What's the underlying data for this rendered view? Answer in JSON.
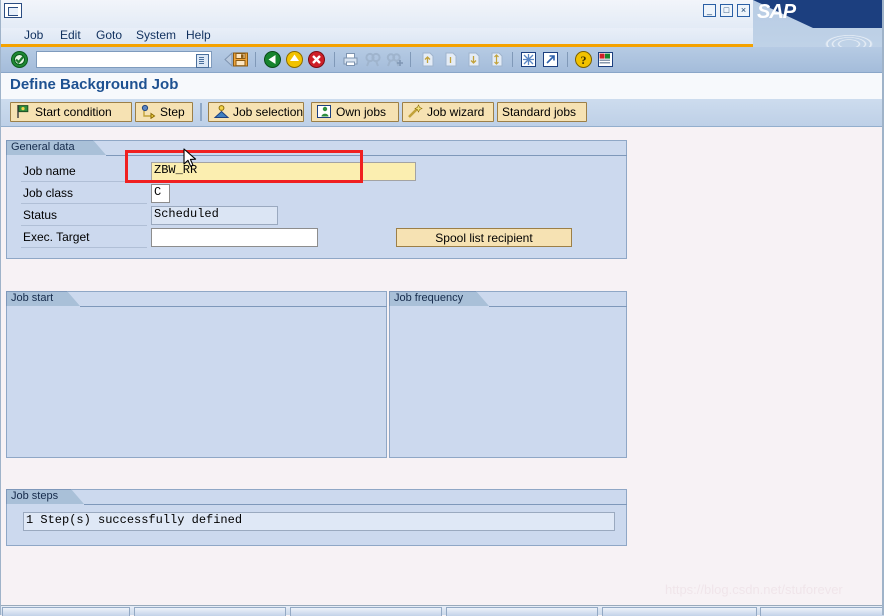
{
  "window": {
    "system_icon": "sap-system-menu-icon",
    "minimize_label": "_",
    "maximize_label": "□",
    "close_label": "×",
    "logo_text": "SAP"
  },
  "menubar": {
    "items": [
      {
        "label": "Job",
        "accel": "J"
      },
      {
        "label": "Edit",
        "accel": "E"
      },
      {
        "label": "Goto",
        "accel": "G"
      },
      {
        "label": "System",
        "accel": "y"
      },
      {
        "label": "Help",
        "accel": "H"
      }
    ]
  },
  "toolbar": {
    "enter_icon": "enter-check-icon",
    "command_field": {
      "value": "",
      "placeholder": "",
      "dropdown_icon": "command-history-icon"
    },
    "icons": [
      "back-arrow-icon",
      "save-icon",
      "green-back-icon",
      "yellow-exit-icon",
      "red-cancel-icon",
      "print-icon",
      "find-icon",
      "find-next-icon",
      "first-page-icon",
      "previous-page-icon",
      "next-page-icon",
      "last-page-icon",
      "create-session-icon",
      "create-shortcut-icon",
      "help-icon",
      "customize-local-layout-icon"
    ]
  },
  "page": {
    "title": "Define Background Job"
  },
  "appbar": {
    "buttons": [
      {
        "label": "Start condition",
        "icon": "flag-icon"
      },
      {
        "label": "Step",
        "icon": "step-icon"
      },
      {
        "label": "Job selection",
        "icon": "job-selection-icon"
      },
      {
        "label": "Own jobs",
        "icon": "own-jobs-icon"
      },
      {
        "label": "Job wizard",
        "icon": "wizard-wand-icon"
      },
      {
        "label": "Standard jobs",
        "icon": ""
      }
    ]
  },
  "general_data": {
    "title": "General data",
    "fields": [
      {
        "label": "Job name",
        "value": "ZBW_RR",
        "state": "required"
      },
      {
        "label": "Job class",
        "value": "C",
        "state": "editable"
      },
      {
        "label": "Status",
        "value": "Scheduled",
        "state": "readonly"
      },
      {
        "label": "Exec. Target",
        "value": "",
        "state": "editable"
      }
    ],
    "spool_button": "Spool list recipient",
    "highlight_color": "#f02020"
  },
  "job_start": {
    "title": "Job start"
  },
  "job_frequency": {
    "title": "Job frequency"
  },
  "job_steps": {
    "title": "Job steps",
    "message": "1 Step(s) successfully defined"
  },
  "watermark": "https://blog.csdn.net/stuforever",
  "colors": {
    "accent_orange": "#f5a200",
    "title_blue": "#1e5191",
    "group_bg": "#ccd9ee",
    "button_tan": "#f6e2b3",
    "required_yellow": "#fbeeb0"
  }
}
